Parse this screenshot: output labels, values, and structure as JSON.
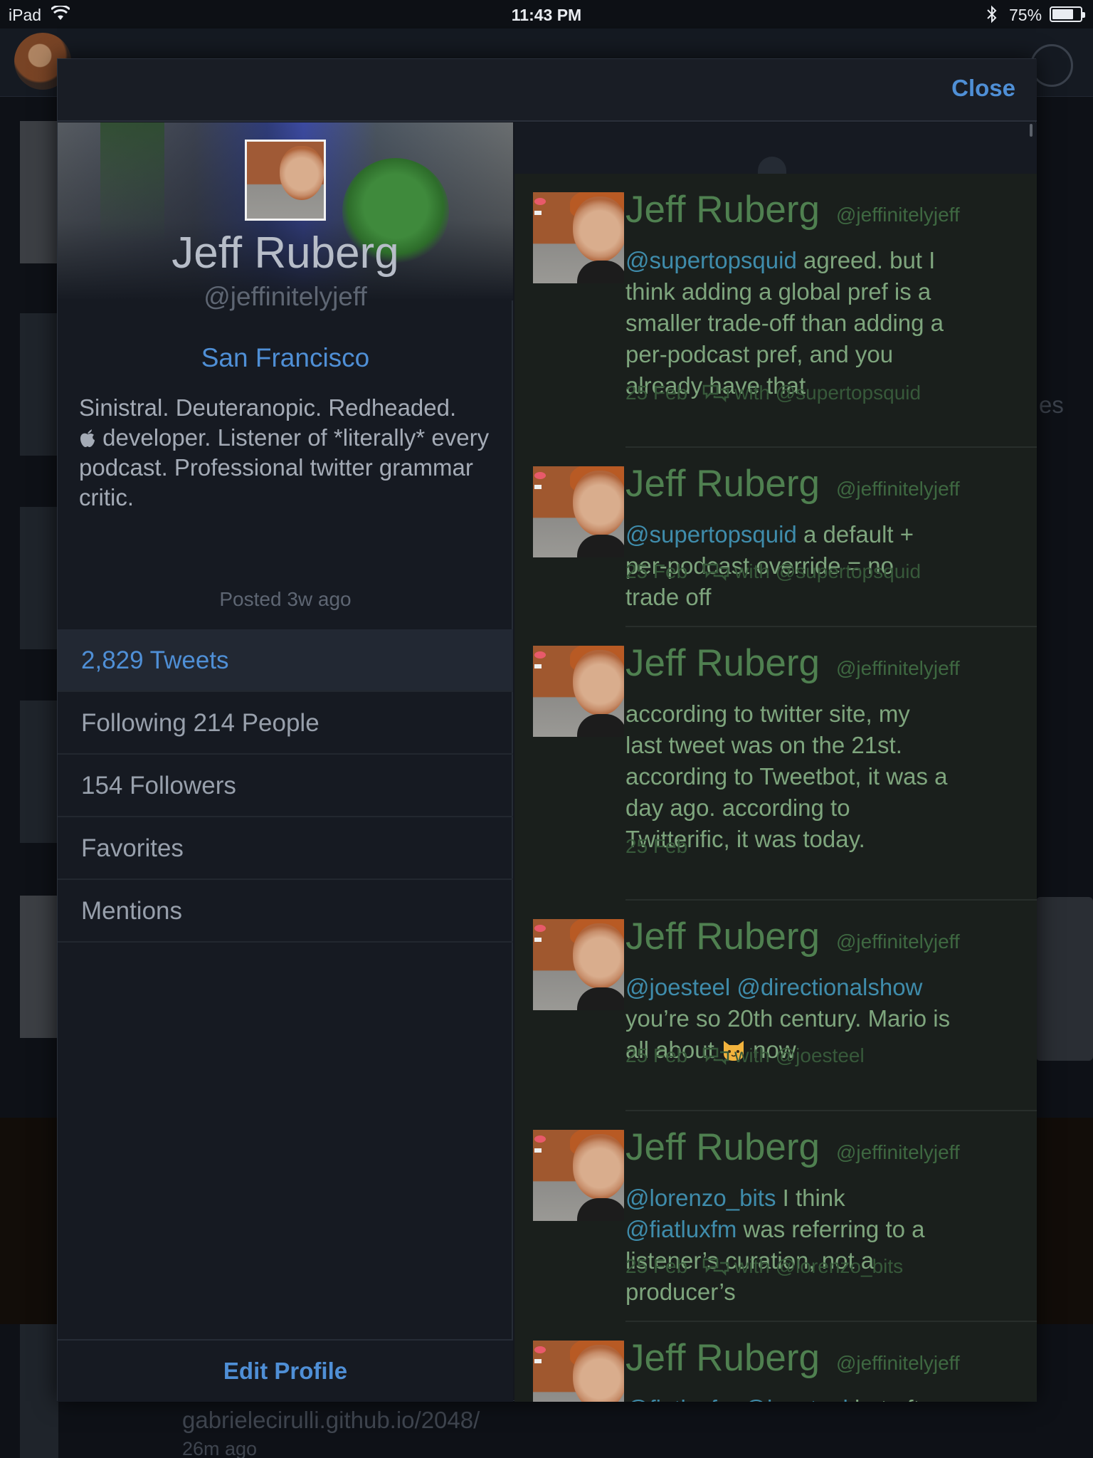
{
  "status_bar": {
    "device": "iPad",
    "time": "11:43 PM",
    "battery_text": "75%",
    "battery_level": 0.75
  },
  "background": {
    "caption_url": "gabrielecirulli.github.io/2048/",
    "caption_time": "26m ago",
    "partial_text": "es"
  },
  "modal": {
    "close_label": "Close"
  },
  "profile": {
    "name": "Jeff Ruberg",
    "handle": "@jeffinitelyjeff",
    "location": "San Francisco",
    "bio_line1": "Sinistral. Deuteranopic. Redheaded.",
    "bio_line2": " developer. Listener of *literally* every podcast. Professional twitter grammar critic.",
    "posted": "Posted 3w ago",
    "menu": [
      {
        "label": "2,829 Tweets",
        "active": true
      },
      {
        "label": "Following 214 People",
        "active": false
      },
      {
        "label": "154 Followers",
        "active": false
      },
      {
        "label": "Favorites",
        "active": false
      },
      {
        "label": "Mentions",
        "active": false
      }
    ],
    "edit_label": "Edit Profile"
  },
  "tweets": [
    {
      "name": "Jeff Ruberg",
      "handle": "@jeffinitelyjeff",
      "mention1": "@supertopsquid",
      "text1": " agreed. but I think adding a global pref is a smaller trade-off than adding a per-podcast pref, and you already have that",
      "date": "25 Feb",
      "conversation": "with @supertopsquid"
    },
    {
      "name": "Jeff Ruberg",
      "handle": "@jeffinitelyjeff",
      "mention1": "@supertopsquid",
      "text1": " a default + per-podcast override = no trade off",
      "date": "25 Feb",
      "conversation": "with @supertopsquid"
    },
    {
      "name": "Jeff Ruberg",
      "handle": "@jeffinitelyjeff",
      "text1": "according to twitter site, my last tweet was on the 21st. according to Tweetbot, it was a day ago. according to Twitterific, it was today.",
      "date": "25 Feb"
    },
    {
      "name": "Jeff Ruberg",
      "handle": "@jeffinitelyjeff",
      "mention1": "@joesteel",
      "mention2": "@directionalshow",
      "text1": "you’re so 20th century. Mario is all about",
      "text2": " now",
      "date": "25 Feb",
      "conversation": "with @joesteel"
    },
    {
      "name": "Jeff Ruberg",
      "handle": "@jeffinitelyjeff",
      "mention1": "@lorenzo_bits",
      "text1": " I think ",
      "mention2": "@fiatluxfm",
      "text2": " was referring to a listener’s curation, not a producer’s",
      "date": "25 Feb",
      "conversation": "with @lorenzo_bits"
    },
    {
      "name": "Jeff Ruberg",
      "handle": "@jeffinitelyjeff",
      "mention1": "@fiatluxfm",
      "mention2": "@joesteel",
      "text1": " but after a"
    }
  ]
}
